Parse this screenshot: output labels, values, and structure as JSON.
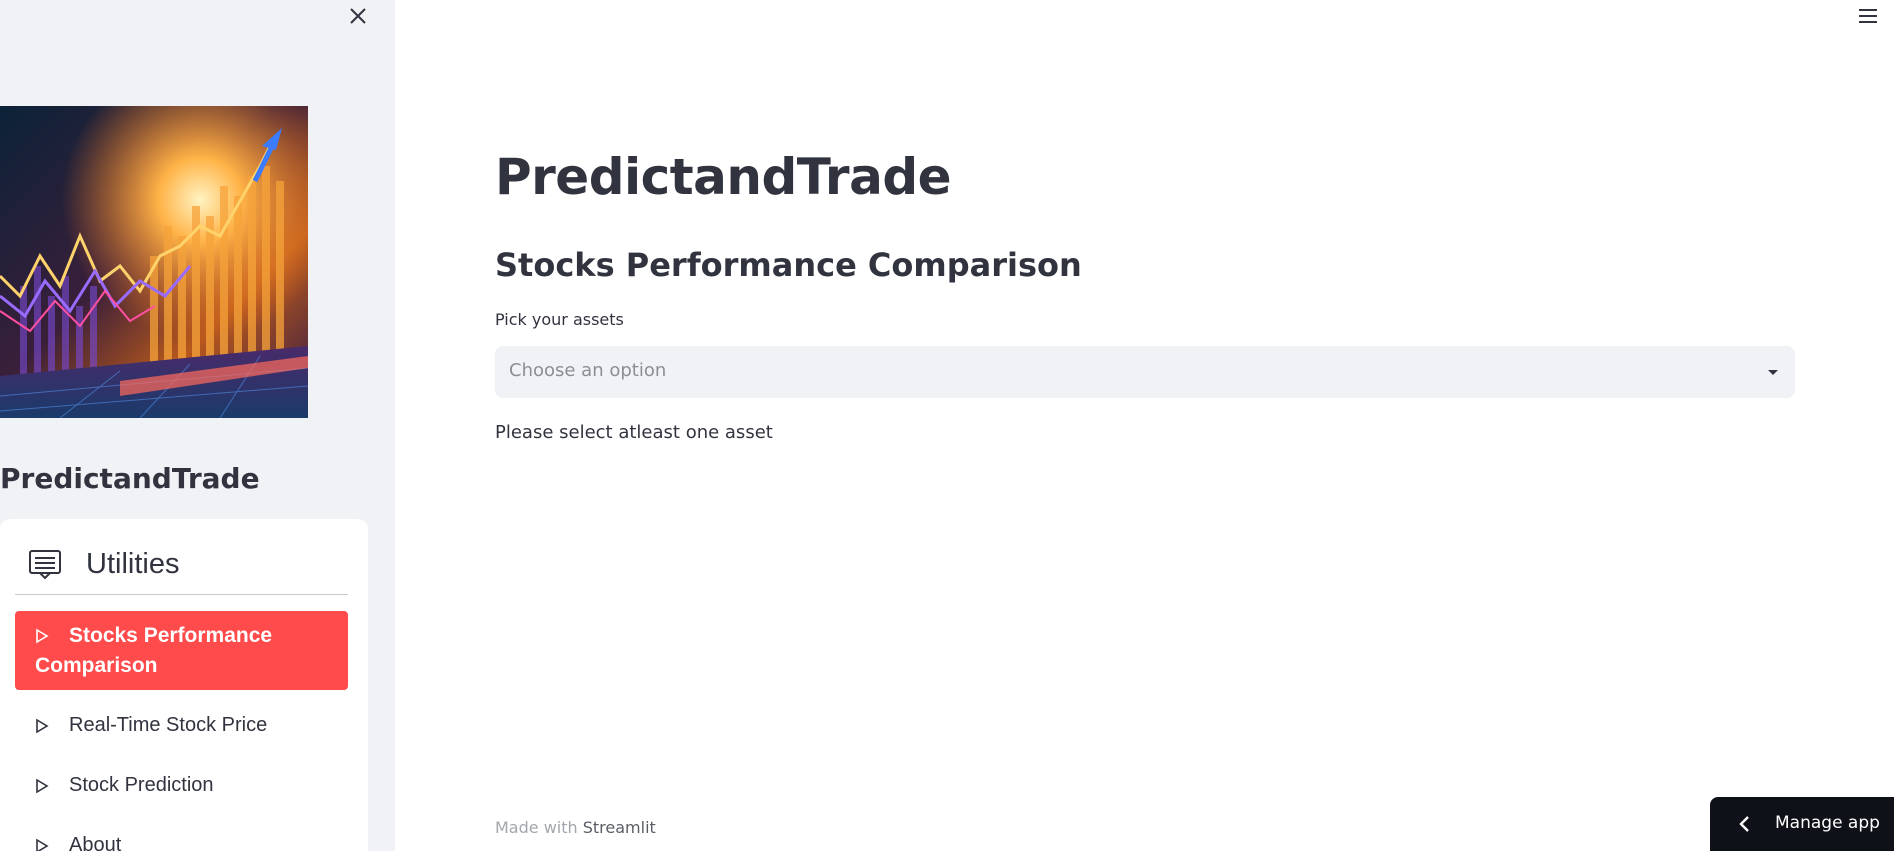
{
  "sidebar": {
    "title": "PredictandTrade",
    "image_name": "stock-chart-hero-image",
    "menu": {
      "header": "Utilities",
      "header_icon": "list-card-icon",
      "items": [
        {
          "label": "Stocks Performance Comparison",
          "active": true,
          "icon": "play-outline-icon"
        },
        {
          "label": "Real-Time Stock Price",
          "active": false,
          "icon": "play-outline-icon"
        },
        {
          "label": "Stock Prediction",
          "active": false,
          "icon": "play-outline-icon"
        },
        {
          "label": "About",
          "active": false,
          "icon": "play-outline-icon"
        }
      ]
    },
    "close_icon": "close-icon"
  },
  "main": {
    "title": "PredictandTrade",
    "subtitle": "Stocks Performance Comparison",
    "select_label": "Pick your assets",
    "select_placeholder": "Choose an option",
    "info": "Please select atleast one asset",
    "footer_prefix": "Made with",
    "footer_brand": "Streamlit"
  },
  "toolbar": {
    "menu_icon": "hamburger-icon"
  },
  "manage_app": {
    "label": "Manage app",
    "icon": "chevron-left-icon"
  },
  "colors": {
    "accent": "#ff4b4b",
    "sidebar_bg": "#f0f2f6",
    "text": "#31333f",
    "manage_bg": "#0e1117"
  }
}
